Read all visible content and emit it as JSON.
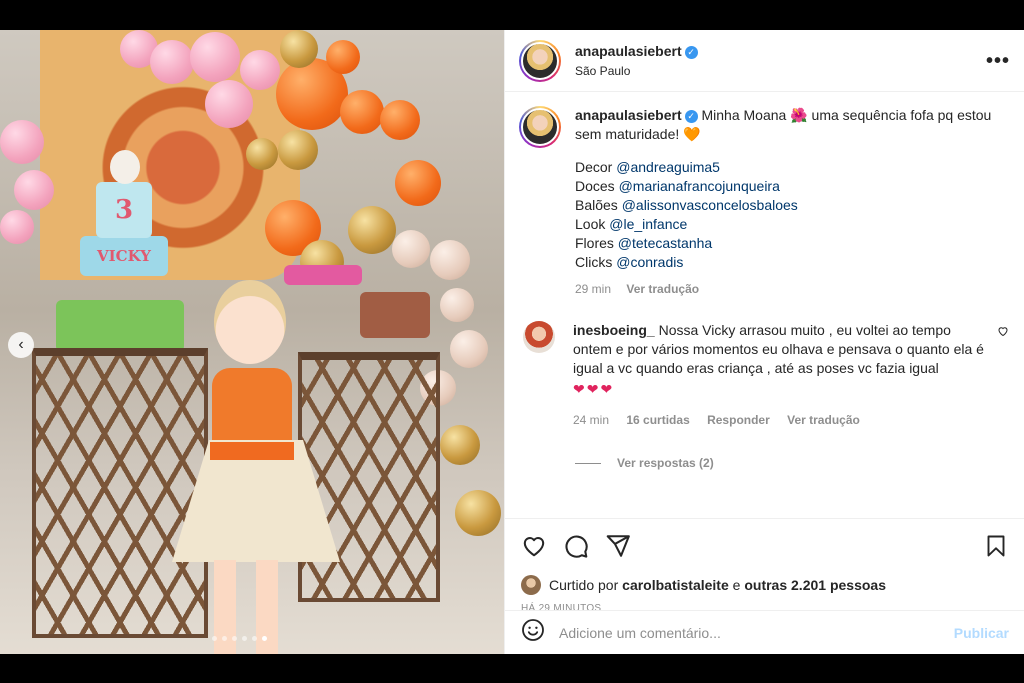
{
  "post": {
    "username": "anapaulasiebert",
    "location": "São Paulo",
    "more_label": "•••"
  },
  "photo": {
    "cake_topper_number": "3",
    "cake_name": "VICKY",
    "carousel_prev": "‹"
  },
  "caption": {
    "username": "anapaulasiebert",
    "text": "Minha Moana 🌺 uma sequência fofa pq estou sem maturidade!",
    "heart": "🧡",
    "credits": [
      {
        "label": "Decor",
        "handle": "@andreaguima5"
      },
      {
        "label": "Doces",
        "handle": "@marianafrancojunqueira"
      },
      {
        "label": "Balões",
        "handle": "@alissonvasconcelosbaloes"
      },
      {
        "label": "Look",
        "handle": "@le_infance"
      },
      {
        "label": "Flores",
        "handle": "@tetecastanha"
      },
      {
        "label": "Clicks",
        "handle": "@conradis"
      }
    ],
    "time": "29 min",
    "translate": "Ver tradução"
  },
  "comment": {
    "username": "inesboeing_",
    "text": "Nossa Vicky arrasou muito , eu voltei ao tempo ontem e por vários momentos eu olhava e pensava o quanto ela é igual a vc quando eras criança , até as poses vc fazia igual",
    "hearts": "❤❤❤",
    "time": "24 min",
    "likes": "16 curtidas",
    "reply": "Responder",
    "translate": "Ver tradução",
    "view_replies": "Ver respostas (2)"
  },
  "likes": {
    "prefix": "Curtido por",
    "user": "carolbatistaleite",
    "connector": "e",
    "others": "outras 2.201 pessoas"
  },
  "timestamp": "HÁ 29 MINUTOS",
  "add_comment": {
    "placeholder": "Adicione um comentário...",
    "publish": "Publicar"
  },
  "colors": {
    "link": "#00376b",
    "muted": "#8e8e8e",
    "verified": "#3897f0",
    "publish_disabled": "#b3dbff",
    "heart": "#e0245e"
  },
  "icons": [
    "verified-icon",
    "more-icon",
    "heart-icon",
    "comment-icon",
    "share-icon",
    "save-icon",
    "emoji-icon",
    "comment-like-icon"
  ],
  "carousel": {
    "count": 6,
    "active_index": 5
  }
}
